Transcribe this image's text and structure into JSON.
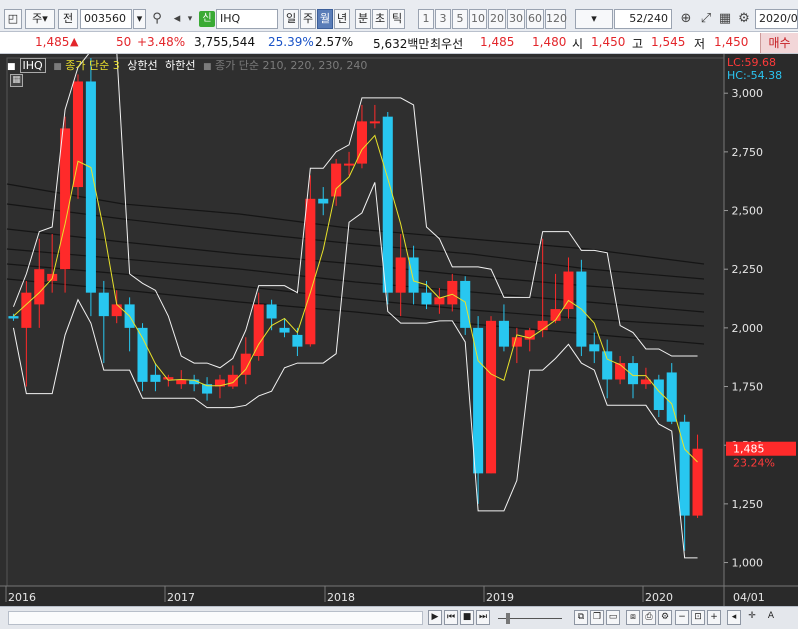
{
  "toolbar": {
    "period_type": "주",
    "prev_label": "전",
    "code": "003560",
    "stock_name": "IHQ",
    "badge": "신",
    "periods": [
      "일",
      "주",
      "월",
      "년",
      "분",
      "초",
      "틱"
    ],
    "selected_period": "월",
    "numbers": [
      "1",
      "3",
      "5",
      "10",
      "20",
      "30",
      "60",
      "120"
    ],
    "count": "52",
    "count_total": "/240",
    "date": "2020/0"
  },
  "quote": {
    "price": "1,485",
    "change": "50",
    "change_pct": "+3.48%",
    "volume": "3,755,544",
    "turnover_pct": "25.39%",
    "ratio_pct": "2.57%",
    "amount": "5,632백만",
    "best_label": "최우선",
    "best_ask": "1,485",
    "best_bid": "1,480",
    "open_label": "시",
    "open": "1,450",
    "high_label": "고",
    "high": "1,545",
    "low_label": "저",
    "low": "1,450",
    "buy_label": "매수"
  },
  "legend": {
    "ticker": "IHQ",
    "ma": "종가 단순 3",
    "upper": "상한선",
    "lower": "하한선",
    "extra": "종가 단순 210, 220, 230, 240"
  },
  "chart_data": {
    "type": "candlestick",
    "ylim": [
      900,
      3150
    ],
    "y_ticks": [
      1000,
      1250,
      1500,
      1750,
      2000,
      2250,
      2500,
      2750,
      3000
    ],
    "y_tick_labels": [
      "1,000",
      "1,250",
      "1,500",
      "1,750",
      "2,000",
      "2,250",
      "2,500",
      "2,750",
      "3,000"
    ],
    "x_labels": [
      "2016",
      "2017",
      "2018",
      "2019",
      "2020",
      "04/01"
    ],
    "lc_label": "LC:59.68",
    "hc_label": "HC:-54.38",
    "current_price_label": "1,485",
    "current_pct_label": "23.24%",
    "candles": [
      {
        "o": 2040,
        "c": 2050,
        "h": 2060,
        "l": 2030,
        "up": false
      },
      {
        "o": 2000,
        "c": 2150,
        "h": 2200,
        "l": 1750,
        "up": true
      },
      {
        "o": 2100,
        "c": 2250,
        "h": 2380,
        "l": 2000,
        "up": true
      },
      {
        "o": 2200,
        "c": 2230,
        "h": 2400,
        "l": 2150,
        "up": true
      },
      {
        "o": 2250,
        "c": 2850,
        "h": 2900,
        "l": 2150,
        "up": true
      },
      {
        "o": 2600,
        "c": 3050,
        "h": 3080,
        "l": 2550,
        "up": true
      },
      {
        "o": 3050,
        "c": 2150,
        "h": 3150,
        "l": 2050,
        "up": false
      },
      {
        "o": 2150,
        "c": 2050,
        "h": 2200,
        "l": 1850,
        "up": false
      },
      {
        "o": 2050,
        "c": 2100,
        "h": 2160,
        "l": 2020,
        "up": true
      },
      {
        "o": 2100,
        "c": 2000,
        "h": 2130,
        "l": 1900,
        "up": false
      },
      {
        "o": 2000,
        "c": 1770,
        "h": 2020,
        "l": 1730,
        "up": false
      },
      {
        "o": 1800,
        "c": 1770,
        "h": 1850,
        "l": 1730,
        "up": false
      },
      {
        "o": 1780,
        "c": 1790,
        "h": 1800,
        "l": 1750,
        "up": true
      },
      {
        "o": 1760,
        "c": 1780,
        "h": 1820,
        "l": 1740,
        "up": true
      },
      {
        "o": 1780,
        "c": 1760,
        "h": 1800,
        "l": 1730,
        "up": false
      },
      {
        "o": 1760,
        "c": 1720,
        "h": 1790,
        "l": 1690,
        "up": false
      },
      {
        "o": 1750,
        "c": 1780,
        "h": 1800,
        "l": 1700,
        "up": true
      },
      {
        "o": 1750,
        "c": 1800,
        "h": 1840,
        "l": 1740,
        "up": true
      },
      {
        "o": 1800,
        "c": 1890,
        "h": 1960,
        "l": 1760,
        "up": true
      },
      {
        "o": 1880,
        "c": 2100,
        "h": 2150,
        "l": 1860,
        "up": true
      },
      {
        "o": 2100,
        "c": 2040,
        "h": 2120,
        "l": 1990,
        "up": false
      },
      {
        "o": 2000,
        "c": 1980,
        "h": 2040,
        "l": 1960,
        "up": false
      },
      {
        "o": 1970,
        "c": 1920,
        "h": 2000,
        "l": 1880,
        "up": false
      },
      {
        "o": 1930,
        "c": 2550,
        "h": 2650,
        "l": 1920,
        "up": true
      },
      {
        "o": 2550,
        "c": 2530,
        "h": 2600,
        "l": 2480,
        "up": false
      },
      {
        "o": 2560,
        "c": 2700,
        "h": 2720,
        "l": 2520,
        "up": true
      },
      {
        "o": 2700,
        "c": 2700,
        "h": 2750,
        "l": 2650,
        "up": true
      },
      {
        "o": 2700,
        "c": 2880,
        "h": 2950,
        "l": 2680,
        "up": true
      },
      {
        "o": 2880,
        "c": 2880,
        "h": 2950,
        "l": 2850,
        "up": true
      },
      {
        "o": 2900,
        "c": 2150,
        "h": 2920,
        "l": 2100,
        "up": false
      },
      {
        "o": 2150,
        "c": 2300,
        "h": 2400,
        "l": 2050,
        "up": true
      },
      {
        "o": 2300,
        "c": 2150,
        "h": 2350,
        "l": 2100,
        "up": false
      },
      {
        "o": 2150,
        "c": 2100,
        "h": 2200,
        "l": 2080,
        "up": false
      },
      {
        "o": 2100,
        "c": 2130,
        "h": 2170,
        "l": 2060,
        "up": true
      },
      {
        "o": 2100,
        "c": 2200,
        "h": 2230,
        "l": 2070,
        "up": true
      },
      {
        "o": 2200,
        "c": 2000,
        "h": 2220,
        "l": 1970,
        "up": false
      },
      {
        "o": 2000,
        "c": 1380,
        "h": 2050,
        "l": 1250,
        "up": false
      },
      {
        "o": 1380,
        "c": 2030,
        "h": 2050,
        "l": 1380,
        "up": true
      },
      {
        "o": 2030,
        "c": 1920,
        "h": 2100,
        "l": 1900,
        "up": false
      },
      {
        "o": 1920,
        "c": 1960,
        "h": 2000,
        "l": 1850,
        "up": true
      },
      {
        "o": 1950,
        "c": 1990,
        "h": 2000,
        "l": 1900,
        "up": true
      },
      {
        "o": 1990,
        "c": 2030,
        "h": 2380,
        "l": 1960,
        "up": true
      },
      {
        "o": 2030,
        "c": 2080,
        "h": 2230,
        "l": 2020,
        "up": true
      },
      {
        "o": 2080,
        "c": 2240,
        "h": 2300,
        "l": 2040,
        "up": true
      },
      {
        "o": 2240,
        "c": 1920,
        "h": 2290,
        "l": 1880,
        "up": false
      },
      {
        "o": 1930,
        "c": 1900,
        "h": 1980,
        "l": 1850,
        "up": false
      },
      {
        "o": 1900,
        "c": 1780,
        "h": 1950,
        "l": 1700,
        "up": false
      },
      {
        "o": 1780,
        "c": 1850,
        "h": 1880,
        "l": 1760,
        "up": true
      },
      {
        "o": 1850,
        "c": 1760,
        "h": 1880,
        "l": 1700,
        "up": false
      },
      {
        "o": 1760,
        "c": 1780,
        "h": 1830,
        "l": 1740,
        "up": true
      },
      {
        "o": 1780,
        "c": 1650,
        "h": 1800,
        "l": 1620,
        "up": false
      },
      {
        "o": 1810,
        "c": 1600,
        "h": 1850,
        "l": 1590,
        "up": false
      },
      {
        "o": 1600,
        "c": 1200,
        "h": 1630,
        "l": 1050,
        "up": false
      },
      {
        "o": 1200,
        "c": 1485,
        "h": 1545,
        "l": 1190,
        "up": true
      }
    ]
  }
}
